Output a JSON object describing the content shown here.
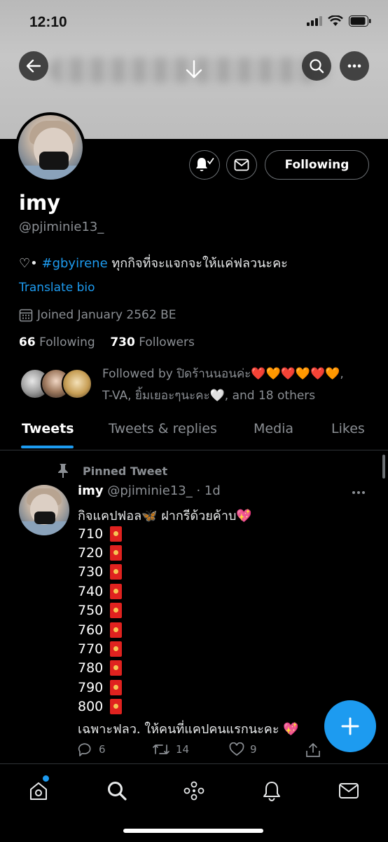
{
  "status": {
    "time": "12:10"
  },
  "profile": {
    "name": "imy",
    "handle": "@pjiminie13_",
    "bio_prefix": "♡•",
    "bio_hashtag": "#gbyirene",
    "bio_text": "ทุกกิจที่จะแจกจะให้แค่ฟลวนะคะ",
    "translate_label": "Translate bio",
    "joined": "Joined January 2562 BE",
    "following_count": "66",
    "following_label": "Following",
    "followers_count": "730",
    "followers_label": "Followers",
    "follow_button_label": "Following",
    "followed_by_line1": "Followed by ปิดร้านนอนค่ะ❤️🧡❤️🧡❤️🧡,",
    "followed_by_line2": "T-VA, ยิ้มเยอะๆนะคะ🤍, and 18 others"
  },
  "tabs": [
    {
      "label": "Tweets"
    },
    {
      "label": "Tweets & replies"
    },
    {
      "label": "Media"
    },
    {
      "label": "Likes"
    }
  ],
  "tweet": {
    "pinned_label": "Pinned Tweet",
    "name": "imy",
    "handle_time": "@pjiminie13_ · 1d",
    "text": "กิจแคปฟอล🦋 ฝากรีด้วยค้าบ💖",
    "lines": [
      "710",
      "720",
      "730",
      "740",
      "750",
      "760",
      "770",
      "780",
      "790",
      "800"
    ],
    "footer_text": "เฉพาะฟลว. ให้คนที่แคปคนแรกนะคะ 💖",
    "replies": "6",
    "retweets": "14",
    "likes": "9"
  },
  "colors": {
    "accent": "#1d9bf0",
    "background": "#000000",
    "muted": "#8b8f94"
  },
  "icons": {
    "back": "arrow-left-icon",
    "search": "search-icon",
    "more": "more-horizontal-icon",
    "notify": "bell-check-icon",
    "message": "envelope-icon",
    "calendar": "calendar-icon",
    "pin": "pin-icon",
    "compose": "plus-icon",
    "nav": [
      "home-icon",
      "search-icon",
      "spaces-icon",
      "bell-icon",
      "mail-icon"
    ]
  }
}
